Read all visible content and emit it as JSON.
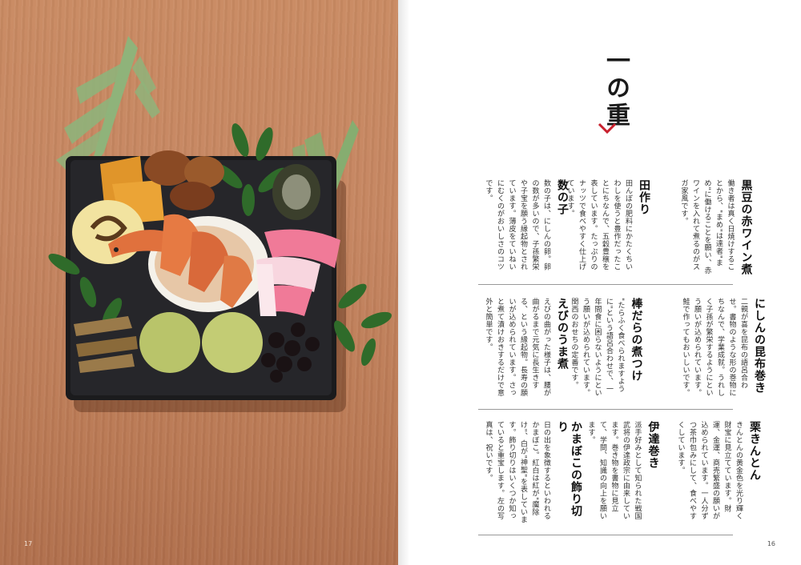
{
  "page": {
    "left_folio": "17",
    "right_folio": "16"
  },
  "heading": {
    "title": "一の重"
  },
  "colors": {
    "accent": "#c8202d",
    "wood": "#c58560",
    "box": "#1b1b1d"
  },
  "items": [
    {
      "title": "黒豆の赤ワイン煮",
      "body": "働き者は真く日焼けすることから、\"まめ\"は達者\"まめ\"に働けることを願い、赤ワインを入れて煮るのがスガ家風です。"
    },
    {
      "title": "田作り",
      "body": "田んぼの肥料にかたくちいわしを使うと豊作だったことにちなんで、五穀豊穣を表しています。たっぷりのナッツで食べやすく仕上げています。"
    },
    {
      "title": "数の子",
      "body": "数の子は、にしんの卵。卵の数が多いので、子孫繁栄や子宝を願う縁起物とされています。薄皮をていねいにむくのがおいしさのコツです。"
    },
    {
      "title": "にしんの昆布巻き",
      "body": "二親が喜を昆布の語呂合わせ。書物のような形の巻物にちなんで、学業成就。うれしく子孫が繁栄するようにという願いが込められています。鮭で作ってもおいしいです。"
    },
    {
      "title": "棒だらの煮つけ",
      "body": "\"たらふく食べられますように\"という語呂合わせで、一年間食に困らないようにという願いが込められています。関西のおせちの定番です。"
    },
    {
      "title": "えびのうま煮",
      "body": "えびの曲がった様子は、腰が曲がるまで元気に長生きする、という縁起物。長寿の願いが込められています。さっと煮て漬けおきするだけで意外と簡単です。"
    },
    {
      "title": "栗きんとん",
      "body": "きんとんの黄金色を光り輝く財宝に見立てています。財運、金運、商売繁盛の願いが込められています。一人分ずつ茶巾包みにして、食べやすくしています。"
    },
    {
      "title": "伊達巻き",
      "body": "派手好みとして知られた戦国武将の伊達政宗に由来しています。巻き物を書物に見立て、学問、知識の向上を願います。"
    },
    {
      "title": "かまぼこの飾り切り",
      "body": "日の出を象徴するといわれるかまぼこ。紅白は紅が\"魔除け\"、白が\"神聖\"を表しています。飾り切りはいくつか知っていると重宝します。左の写真は、祝いです。"
    }
  ]
}
